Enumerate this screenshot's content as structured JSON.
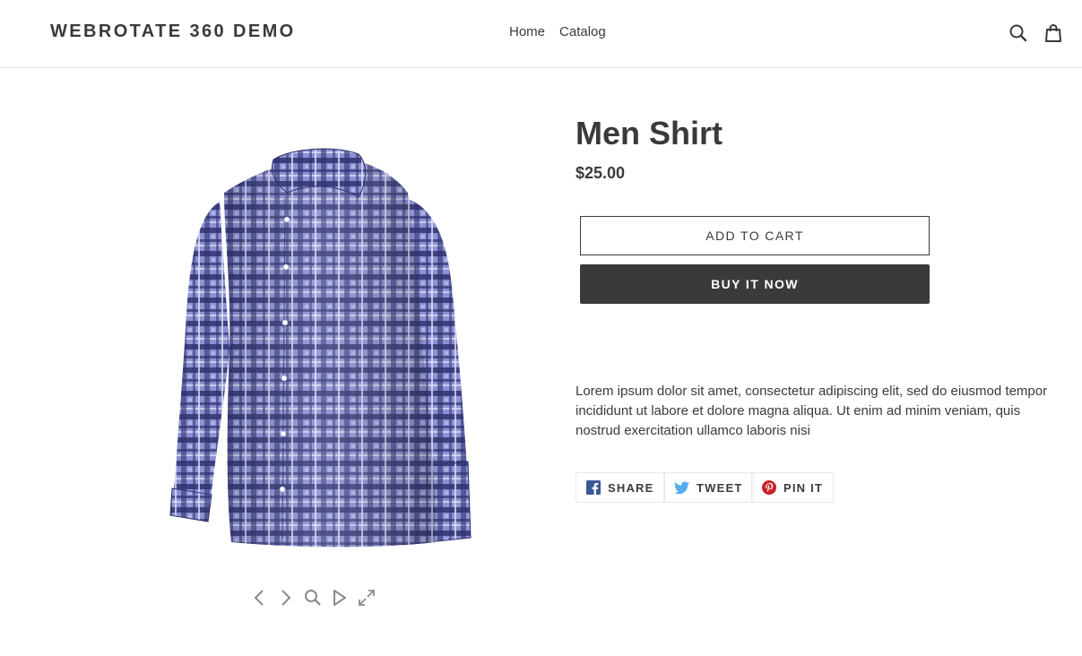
{
  "header": {
    "logo": "WEBROTATE 360 DEMO",
    "nav": [
      "Home",
      "Catalog"
    ],
    "icons": [
      "search-icon",
      "cart-icon"
    ]
  },
  "product": {
    "title": "Men Shirt",
    "price": "$25.00",
    "add_to_cart": "ADD TO CART",
    "buy_now": "BUY IT NOW",
    "description": "Lorem ipsum dolor sit amet, consectetur adipiscing elit, sed do eiusmod tempor incididunt ut labore et dolore magna aliqua. Ut enim ad minim veniam, quis nostrud exercitation ullamco laboris nisi",
    "image_colors": {
      "plaid_base": "#6f74c2",
      "plaid_dark": "#2b2f66",
      "plaid_light": "#c9cbee"
    }
  },
  "viewer_controls": [
    "chevron-left-icon",
    "chevron-right-icon",
    "zoom-icon",
    "play-icon",
    "fullscreen-icon"
  ],
  "share": {
    "facebook": "SHARE",
    "twitter": "TWEET",
    "pinterest": "PIN IT",
    "colors": {
      "facebook": "#3b5998",
      "twitter": "#00aced",
      "pinterest": "#cb2027"
    }
  }
}
